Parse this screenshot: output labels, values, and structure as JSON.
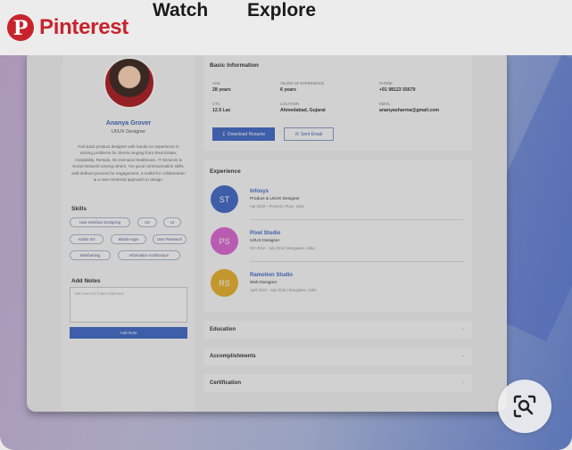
{
  "header": {
    "brand": "Pinterest",
    "brand_glyph": "P",
    "nav": {
      "watch": "Watch",
      "explore": "Explore"
    },
    "brand_color": "#c8232c"
  },
  "pin": {
    "profile": {
      "name": "Ananya Grover",
      "role": "UI/UX Designer",
      "bio": "Full stack product designer with hands-on experience in solving problems for clients ranging from Real Estate, Hospitality, Rentals, On Demand Healthcare, IT Services & Social Network among others. I've good communication skills, well-defined process for engagement, a toolkit for collaboration & a user-centered approach to design.",
      "skills_title": "Skills",
      "skills": [
        "User Interface Designing",
        "UX",
        "UI",
        "Adobe XD",
        "Mobile Apps",
        "User Research",
        "Wireframing",
        "Information Architecture"
      ],
      "notes_title": "Add Notes",
      "notes_placeholder": "Add notes for future reference",
      "add_note_label": "Add Note"
    },
    "basic": {
      "title": "Basic Information",
      "fields": [
        {
          "label": "AGE",
          "value": "28 years"
        },
        {
          "label": "YEARS OF EXPERIENCE",
          "value": "6 years"
        },
        {
          "label": "PHONE",
          "value": "+91 98123 55679"
        },
        {
          "label": "CTC",
          "value": "12.5 Lac"
        },
        {
          "label": "LOCATION",
          "value": "Ahmedabad, Gujarat"
        },
        {
          "label": "EMAIL",
          "value": "ananyasharma@gmail.com"
        }
      ],
      "download_label": "Download Resume",
      "email_label": "Sent Email"
    },
    "experience": {
      "title": "Experience",
      "items": [
        {
          "initials": "ST",
          "company": "Infosys",
          "role": "Product & UI/UX Designer",
          "dates": "Apr 2018 – Present  |  Pune, India",
          "color": "#3f63b6"
        },
        {
          "initials": "PS",
          "company": "Pixel Studio",
          "role": "UI/UX Designer",
          "dates": "Oct 2016 - July 2016  |  Bengaluru, India",
          "color": "#c95fc0"
        },
        {
          "initials": "RS",
          "company": "Ramotion Studio",
          "role": "Web Designer",
          "dates": "April 2015 - July 2016  |  Bengaluru, India",
          "color": "#d4a22d"
        }
      ]
    },
    "sections": [
      "Education",
      "Accomplishments",
      "Certification"
    ]
  },
  "lens": {
    "icon": "visual-search-icon"
  }
}
